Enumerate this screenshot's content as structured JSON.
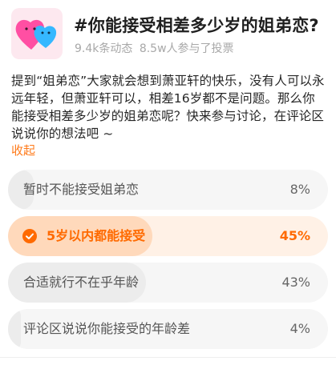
{
  "topic": {
    "thumbnail_icon": "pink-and-blue-hearts-icon",
    "title": "#你能接受相差多少岁的姐弟恋?",
    "stats": {
      "posts": "9.4k条动态",
      "participants": "8.5w人参与了投票"
    },
    "description": "提到“姐弟恋”大家就会想到萧亚轩的快乐，没有人可以永远年轻，但萧亚轩可以，相差16岁都不是问题。那么你能接受相差多少岁的姐弟恋呢？快来参与讨论，在评论区说说你的想法吧 ~",
    "collapse_label": "收起"
  },
  "poll": {
    "accent_color": "#ff6a00",
    "options": [
      {
        "label": "暂时不能接受姐弟恋",
        "percent": "8%",
        "fraction": 0.08,
        "selected": false
      },
      {
        "label": "5岁以内都能接受",
        "percent": "45%",
        "fraction": 0.45,
        "selected": true
      },
      {
        "label": "合适就行不在乎年龄",
        "percent": "43%",
        "fraction": 0.43,
        "selected": false
      },
      {
        "label": "评论区说说你能接受的年龄差",
        "percent": "4%",
        "fraction": 0.04,
        "selected": false
      }
    ]
  }
}
